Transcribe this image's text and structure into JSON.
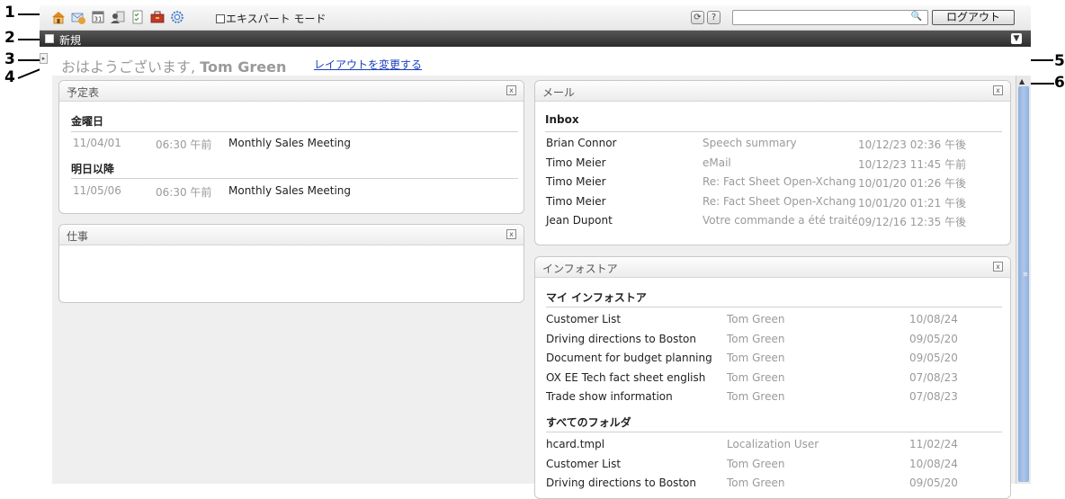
{
  "callouts": [
    "1",
    "2",
    "3",
    "4",
    "5",
    "6"
  ],
  "toolbar": {
    "icons": [
      "home-icon",
      "mail-icon",
      "calendar-icon",
      "contacts-icon",
      "tasks-icon",
      "infostore-icon",
      "settings-icon"
    ],
    "expert_mode_label": "エキスパート モード",
    "refresh_icon": "refresh-icon",
    "help_label": "?",
    "search_placeholder": "",
    "logout_label": "ログアウト"
  },
  "new_bar": {
    "label": "新規"
  },
  "greeting": {
    "text": "おはようございます, ",
    "user_name": "Tom Green"
  },
  "change_layout_label": "レイアウトを変更する",
  "calendar_widget": {
    "title": "予定表",
    "sections": [
      {
        "heading": "金曜日",
        "items": [
          {
            "date": "11/04/01",
            "time": "06:30 午前",
            "subject": "Monthly Sales Meeting"
          }
        ]
      },
      {
        "heading": "明日以降",
        "items": [
          {
            "date": "11/05/06",
            "time": "06:30 午前",
            "subject": "Monthly Sales Meeting"
          }
        ]
      }
    ]
  },
  "tasks_widget": {
    "title": "仕事"
  },
  "mail_widget": {
    "title": "メール",
    "folder": "Inbox",
    "messages": [
      {
        "from": "Brian Connor",
        "subject": "Speech summary",
        "date": "10/12/23 02:36 午後"
      },
      {
        "from": "Timo Meier",
        "subject": "eMail",
        "date": "10/12/23 11:45 午前"
      },
      {
        "from": "Timo Meier",
        "subject": "Re: Fact Sheet Open-Xchang",
        "date": "10/01/20 01:26 午後"
      },
      {
        "from": "Timo Meier",
        "subject": "Re: Fact Sheet Open-Xchang",
        "date": "10/01/20 01:21 午後"
      },
      {
        "from": "Jean Dupont",
        "subject": "Votre commande a été traitée",
        "date": "09/12/16 12:35 午後"
      }
    ]
  },
  "infostore_widget": {
    "title": "インフォストア",
    "sections": [
      {
        "heading": "マイ インフォストア",
        "items": [
          {
            "name": "Customer List",
            "owner": "Tom Green",
            "date": "10/08/24"
          },
          {
            "name": "Driving directions to Boston",
            "owner": "Tom Green",
            "date": "09/05/20"
          },
          {
            "name": "Document for budget planning",
            "owner": "Tom Green",
            "date": "09/05/20"
          },
          {
            "name": "OX EE Tech fact sheet english",
            "owner": "Tom Green",
            "date": "07/08/23"
          },
          {
            "name": "Trade show information",
            "owner": "Tom Green",
            "date": "07/08/23"
          }
        ]
      },
      {
        "heading": "すべてのフォルダ",
        "items": [
          {
            "name": "hcard.tmpl",
            "owner": "Localization User",
            "date": "11/02/24"
          },
          {
            "name": "Customer List",
            "owner": "Tom Green",
            "date": "10/08/24"
          },
          {
            "name": "Driving directions to Boston",
            "owner": "Tom Green",
            "date": "09/05/20"
          }
        ]
      }
    ]
  },
  "colors": {
    "link": "#1a3fbf",
    "new_bar": "#3a3a3a",
    "scroll_thumb": "#9fbbe6"
  }
}
